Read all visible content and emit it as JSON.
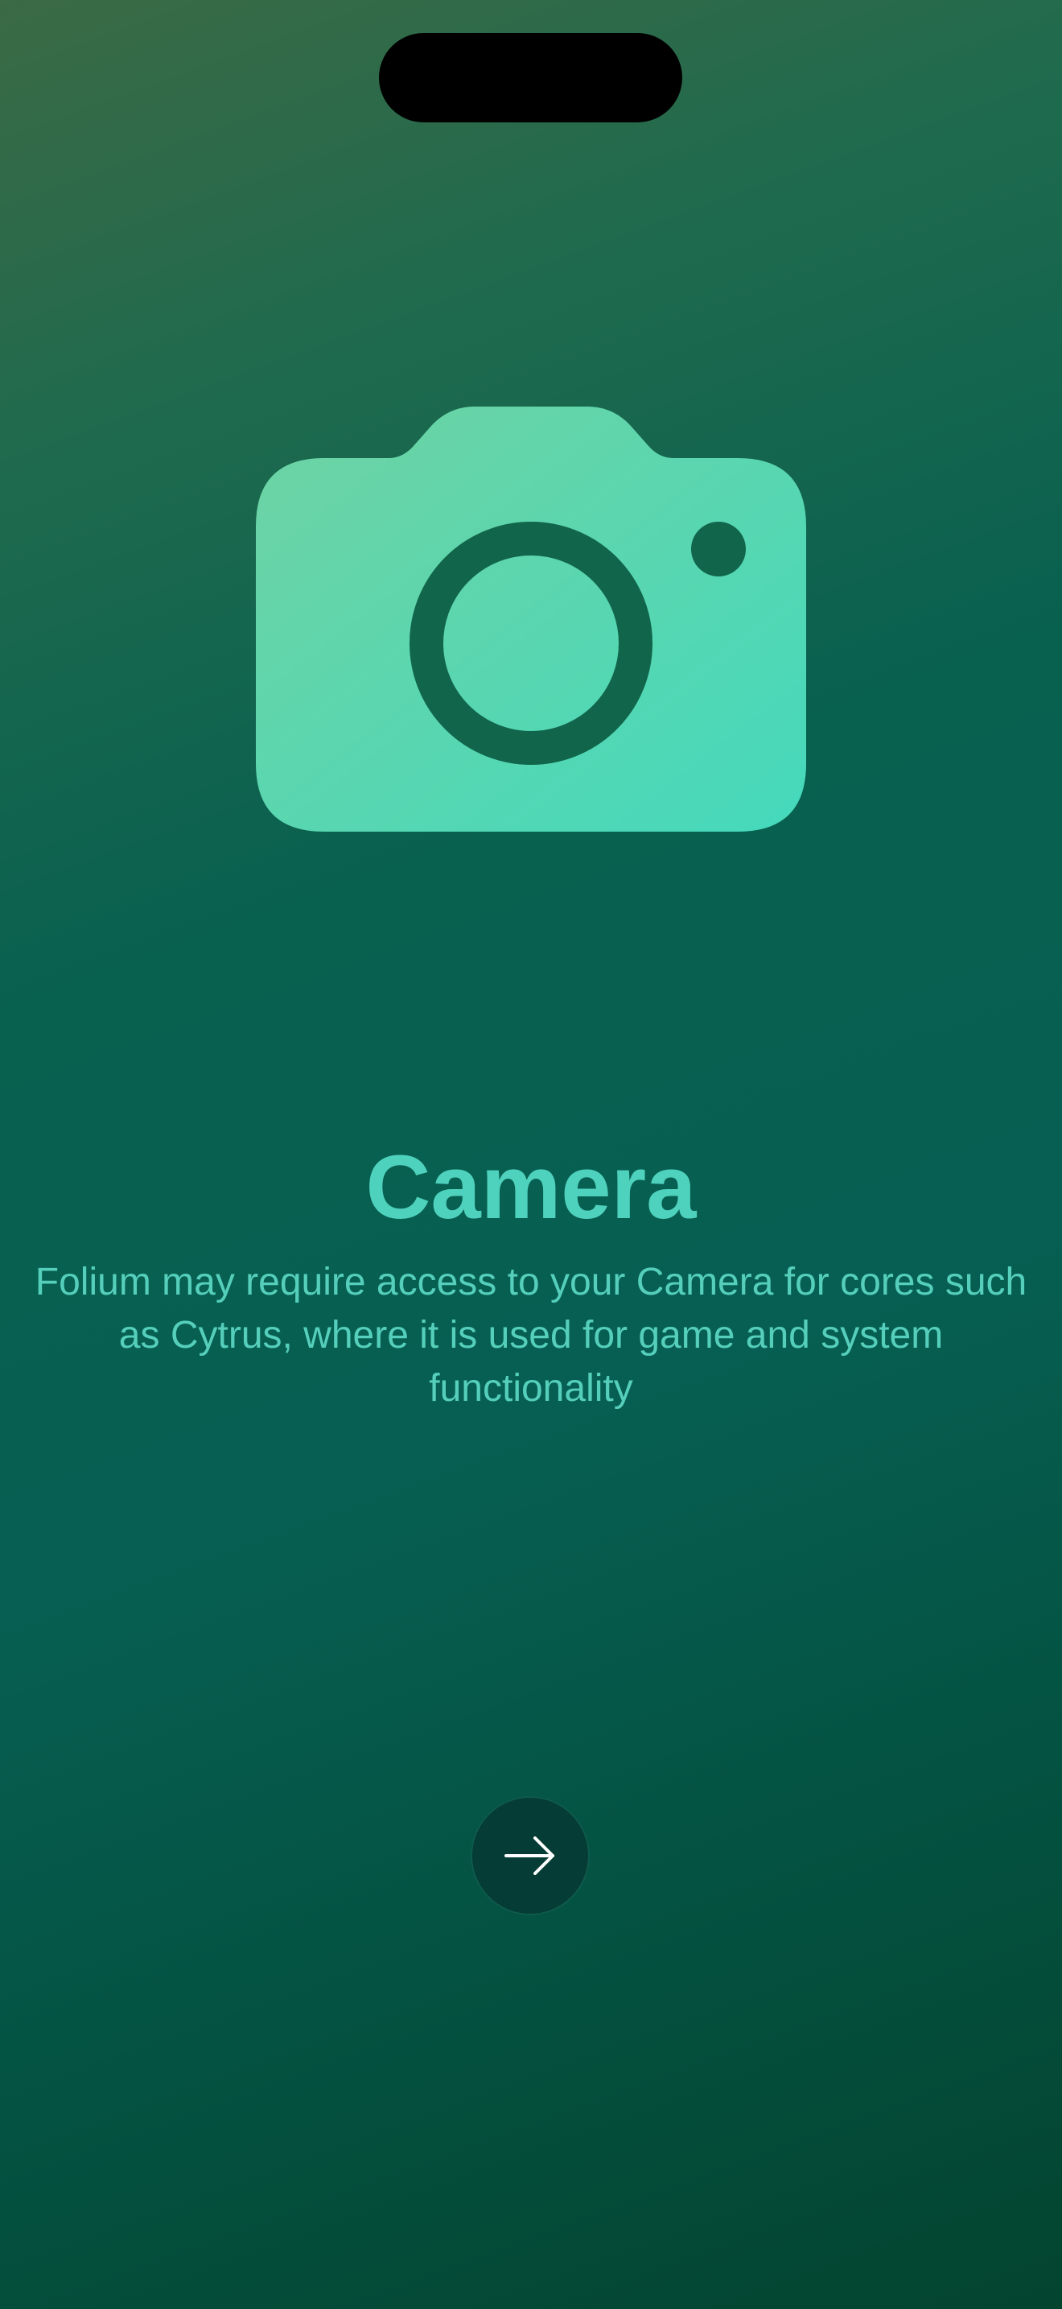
{
  "permission": {
    "icon": "camera-icon",
    "title": "Camera",
    "description": "Folium may require access to your Camera for cores such as Cytrus, where it is used for game and system functionality"
  },
  "controls": {
    "next_icon": "arrow-right-icon"
  },
  "colors": {
    "accent": "#4fd2bd",
    "icon_fill": "#5cd6b2",
    "button_bg": "#053c35",
    "button_icon": "#ffffff"
  }
}
